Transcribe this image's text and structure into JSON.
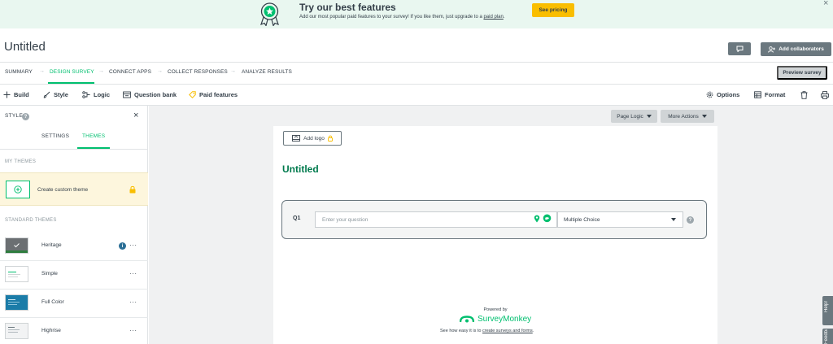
{
  "promo": {
    "title": "Try our best features",
    "subtitle_pre": "Add our most popular paid features to your survey! If you like them, just upgrade to a",
    "subtitle_link": "paid plan",
    "subtitle_post": ".",
    "cta": "See pricing",
    "close": "×"
  },
  "header": {
    "title": "Untitled",
    "add_collaborators": "Add collaborators"
  },
  "steps": [
    {
      "label": "SUMMARY"
    },
    {
      "label": "DESIGN SURVEY"
    },
    {
      "label": "CONNECT APPS"
    },
    {
      "label": "COLLECT RESPONSES"
    },
    {
      "label": "ANALYZE RESULTS"
    }
  ],
  "preview_button": "Preview survey",
  "toolbar": {
    "build": "Build",
    "style": "Style",
    "logic": "Logic",
    "question_bank": "Question bank",
    "paid_features": "Paid features",
    "options": "Options",
    "format": "Format"
  },
  "style_panel": {
    "title": "STYLE",
    "help": "?",
    "close": "×",
    "tabs": {
      "settings": "SETTINGS",
      "themes": "THEMES"
    },
    "my_themes": "MY THEMES",
    "create_custom": "Create custom theme",
    "standard_themes": "STANDARD THEMES",
    "themes": [
      {
        "name": "Heritage",
        "more": "···"
      },
      {
        "name": "Simple",
        "more": "···"
      },
      {
        "name": "Full Color",
        "more": "···"
      },
      {
        "name": "Highrise",
        "more": "···"
      }
    ],
    "heritage_badge": "i"
  },
  "canvas": {
    "page_logic": "Page Logic",
    "more_actions": "More Actions",
    "add_logo": "Add logo",
    "survey_title": "Untitled",
    "question": {
      "number": "Q1",
      "placeholder": "Enter your question",
      "type": "Multiple Choice",
      "help": "?"
    },
    "powered_by": "Powered by",
    "brand": "SurveyMonkey",
    "tagline_pre": "See how easy it is to",
    "tagline_link": "create surveys and forms",
    "tagline_post": "."
  },
  "side_tabs": {
    "help": "Help!",
    "feedback": "Feedback"
  },
  "colors": {
    "brand_green": "#00bf6f",
    "title_green": "#007a4d",
    "promo_bg": "#e9f7f0",
    "cta_yellow": "#f9be00",
    "button_gray": "#6b787f"
  }
}
